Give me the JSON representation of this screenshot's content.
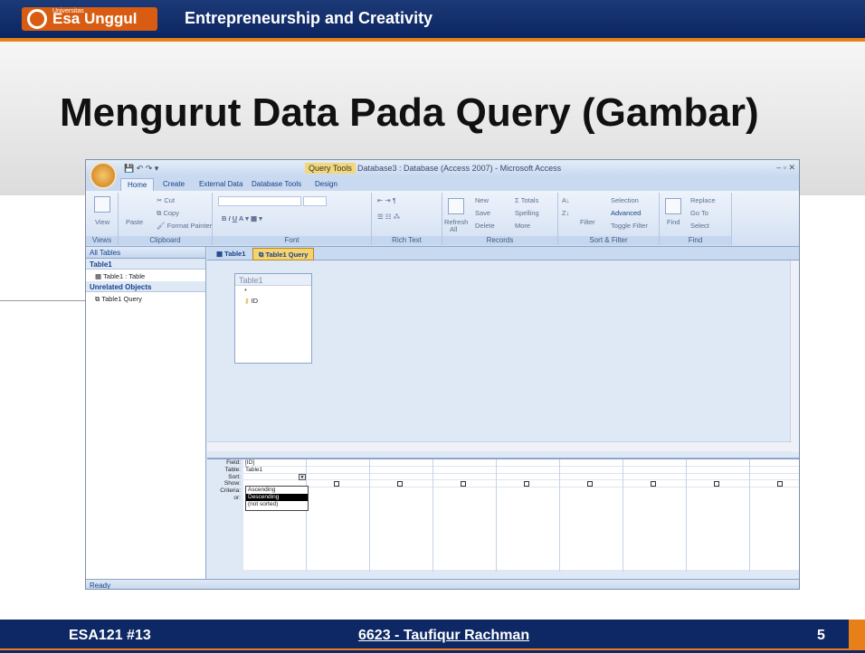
{
  "slide": {
    "logo_small": "Universitas",
    "logo": "Esa Unggul",
    "course": "Entrepreneurship and Creativity",
    "title": "Mengurut Data Pada Query (Gambar)",
    "footer_left": "ESA121 #13",
    "footer_center": "6623 - Taufiqur Rachman",
    "page": "5"
  },
  "window": {
    "title": "Database3 : Database (Access 2007) - Microsoft Access",
    "context": "Query Tools",
    "controls": "– ▫ ✕"
  },
  "tabs": [
    "Home",
    "Create",
    "External Data",
    "Database Tools",
    "Design"
  ],
  "ribbon": {
    "views": "Views",
    "view": "View",
    "clipboard": "Clipboard",
    "paste": "Paste",
    "cut": "Cut",
    "copy": "Copy",
    "format_painter": "Format Painter",
    "font": "Font",
    "rich_text": "Rich Text",
    "records": "Records",
    "refresh": "Refresh",
    "all": "All",
    "new": "New",
    "save": "Save",
    "delete": "Delete",
    "totals": "Totals",
    "spelling": "Spelling",
    "more": "More",
    "sort_filter": "Sort & Filter",
    "filter": "Filter",
    "selection": "Selection",
    "advanced": "Advanced",
    "toggle_filter": "Toggle Filter",
    "find_grp": "Find",
    "find": "Find",
    "replace": "Replace",
    "goto": "Go To",
    "select": "Select"
  },
  "nav": {
    "header": "All Tables",
    "sec1": "Table1",
    "item1": "Table1 : Table",
    "sec2": "Unrelated Objects",
    "item2": "Table1 Query"
  },
  "doc_tabs": [
    "Table1",
    "Table1 Query"
  ],
  "table_box": {
    "name": "Table1",
    "star": "*",
    "field": "ID"
  },
  "grid": {
    "labels": [
      "Field:",
      "Table:",
      "Sort:",
      "Show:",
      "Criteria:",
      "or:"
    ],
    "field": "[ID]",
    "table": "Table1",
    "sort_options": [
      "Ascending",
      "Descending",
      "(not sorted)"
    ]
  },
  "status": "Ready"
}
